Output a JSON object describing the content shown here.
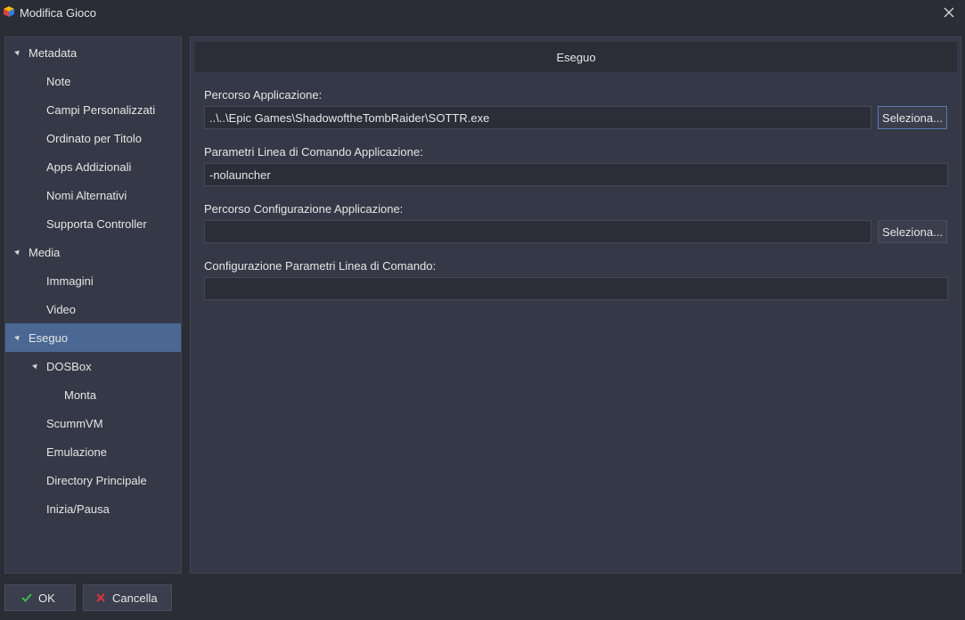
{
  "window": {
    "title": "Modifica Gioco",
    "app_icon": "launchbox-cube-icon",
    "close_icon": "close-icon"
  },
  "sidebar": {
    "items": [
      {
        "label": "Metadata",
        "level": 0,
        "expanded": true
      },
      {
        "label": "Note",
        "level": 1
      },
      {
        "label": "Campi Personalizzati",
        "level": 1
      },
      {
        "label": "Ordinato per Titolo",
        "level": 1
      },
      {
        "label": "Apps Addizionali",
        "level": 1
      },
      {
        "label": "Nomi Alternativi",
        "level": 1
      },
      {
        "label": "Supporta Controller",
        "level": 1
      },
      {
        "label": "Media",
        "level": 0,
        "expanded": true
      },
      {
        "label": "Immagini",
        "level": 1
      },
      {
        "label": "Video",
        "level": 1
      },
      {
        "label": "Eseguo",
        "level": 0,
        "expanded": true,
        "selected": true
      },
      {
        "label": "DOSBox",
        "level": 1,
        "expanded": true
      },
      {
        "label": "Monta",
        "level": 2
      },
      {
        "label": "ScummVM",
        "level": 1
      },
      {
        "label": "Emulazione",
        "level": 1
      },
      {
        "label": "Directory Principale",
        "level": 1
      },
      {
        "label": "Inizia/Pausa",
        "level": 1
      }
    ]
  },
  "main": {
    "header": "Eseguo",
    "app_path": {
      "label": "Percorso Applicazione:",
      "value": "..\\..\\Epic Games\\ShadowoftheTombRaider\\SOTTR.exe",
      "button": "Seleziona..."
    },
    "app_args": {
      "label": "Parametri Linea di Comando Applicazione:",
      "value": "-nolauncher"
    },
    "config_path": {
      "label": "Percorso Configurazione Applicazione:",
      "value": "",
      "button": "Seleziona..."
    },
    "config_args": {
      "label": "Configurazione Parametri Linea di Comando:",
      "value": ""
    }
  },
  "footer": {
    "ok_label": "OK",
    "cancel_label": "Cancella",
    "ok_icon": "checkmark-icon",
    "cancel_icon": "cross-icon"
  },
  "colors": {
    "accent_selected": "#4b6894",
    "ok_green": "#3fb950",
    "cancel_red": "#d9363e"
  }
}
